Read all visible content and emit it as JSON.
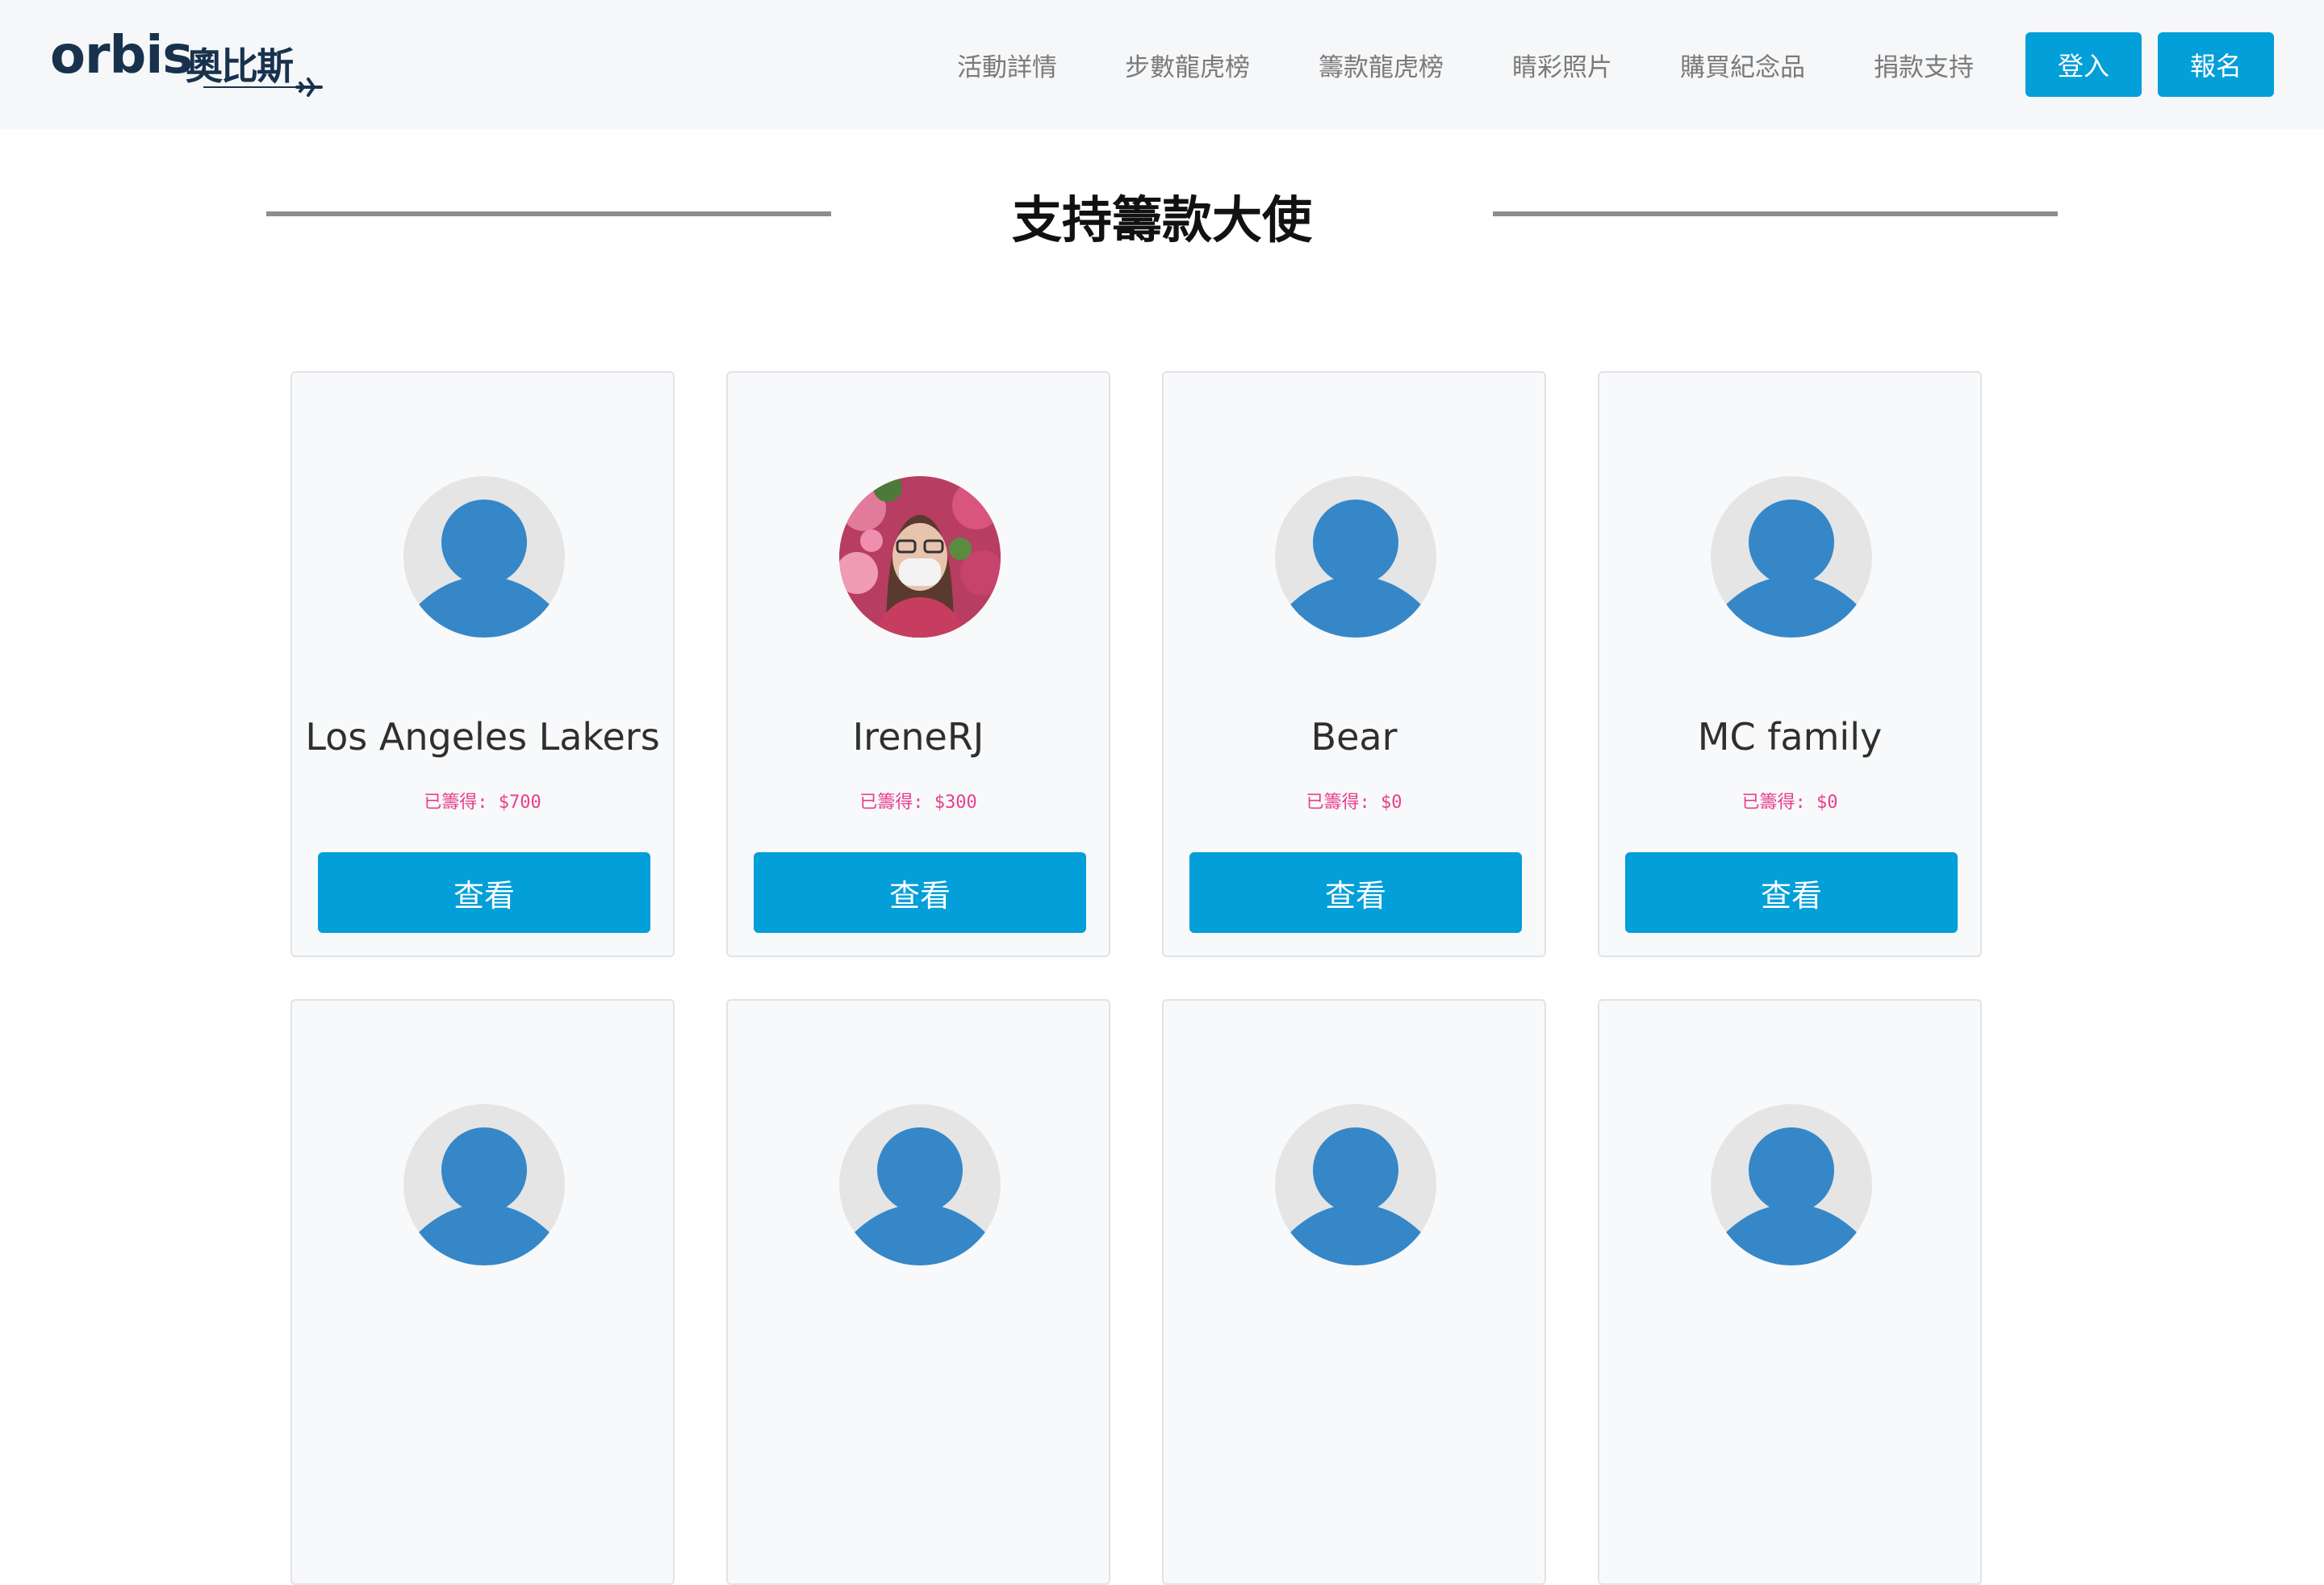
{
  "brand": {
    "logo_latin": "orbis",
    "logo_cjk": "奧比斯"
  },
  "nav": {
    "links": [
      "活動詳情",
      "步數龍虎榜",
      "籌款龍虎榜",
      "睛彩照片",
      "購買紀念品",
      "捐款支持"
    ],
    "login": "登入",
    "signup": "報名"
  },
  "section": {
    "title": "支持籌款大使"
  },
  "cards": [
    {
      "name": "Los Angeles Lakers",
      "raised": "已籌得: $700",
      "button": "查看",
      "avatar": "default-avatar-icon"
    },
    {
      "name": "IreneRJ",
      "raised": "已籌得: $300",
      "button": "查看",
      "avatar": "profile-photo"
    },
    {
      "name": "Bear",
      "raised": "已籌得: $0",
      "button": "查看",
      "avatar": "default-avatar-icon"
    },
    {
      "name": "MC family",
      "raised": "已籌得: $0",
      "button": "查看",
      "avatar": "default-avatar-icon"
    },
    {
      "avatar": "default-avatar-icon"
    },
    {
      "avatar": "default-avatar-icon"
    },
    {
      "avatar": "default-avatar-icon"
    },
    {
      "avatar": "default-avatar-icon"
    }
  ],
  "colors": {
    "accent": "#039fd8",
    "avatar_blue": "#3587c8",
    "avatar_bg": "#e5e5e5",
    "raised_text": "#e83e8c",
    "nav_bg": "#f6f7f9"
  }
}
